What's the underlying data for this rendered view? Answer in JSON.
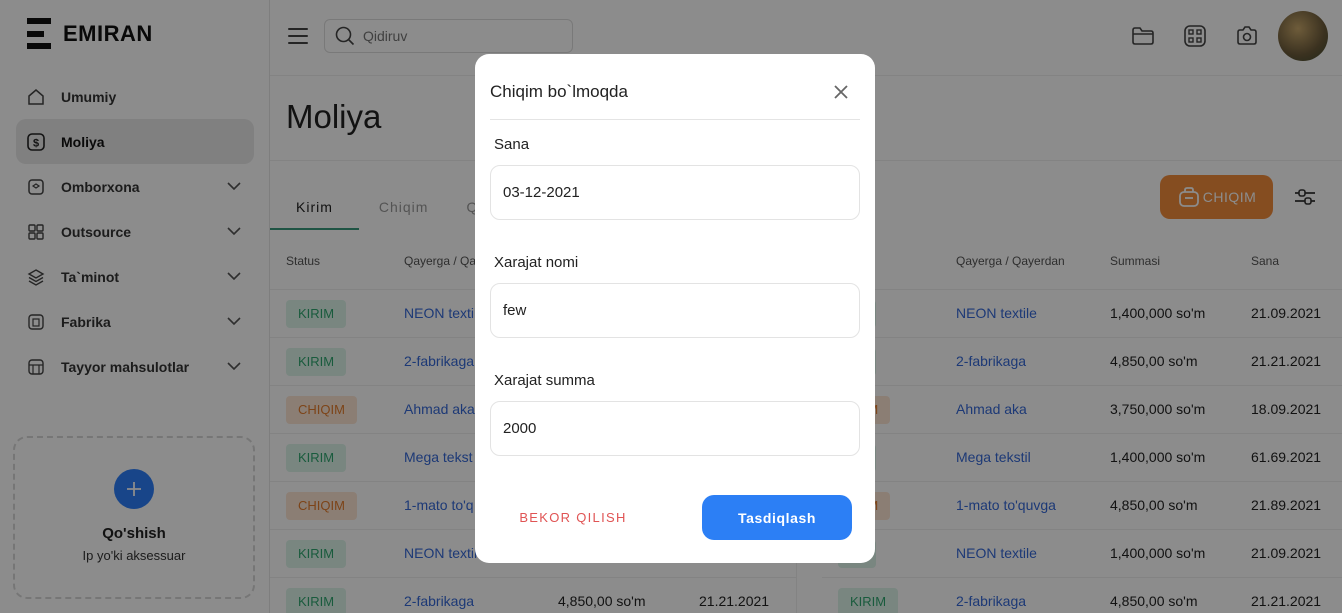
{
  "brand": {
    "name": "EMIRAN"
  },
  "sidebar": {
    "items": [
      {
        "label": "Umumiy",
        "icon": "home-icon",
        "active": false,
        "expandable": false
      },
      {
        "label": "Moliya",
        "icon": "dollar-icon",
        "active": true,
        "expandable": false
      },
      {
        "label": "Omborxona",
        "icon": "box-icon",
        "active": false,
        "expandable": true
      },
      {
        "label": "Outsource",
        "icon": "grid-icon",
        "active": false,
        "expandable": true
      },
      {
        "label": "Ta`minot",
        "icon": "layers-icon",
        "active": false,
        "expandable": true
      },
      {
        "label": "Fabrika",
        "icon": "factory-icon",
        "active": false,
        "expandable": true
      },
      {
        "label": "Tayyor mahsulotlar",
        "icon": "store-icon",
        "active": false,
        "expandable": true
      }
    ],
    "add_card": {
      "title": "Qo'shish",
      "subtitle": "Ip yo'ki aksessuar"
    }
  },
  "header": {
    "search_placeholder": "Qidiruv",
    "icons": [
      "folder-icon",
      "qr-scan-icon",
      "camera-icon"
    ]
  },
  "page": {
    "title": "Moliya",
    "tabs": [
      {
        "label": "Kirim",
        "active": true
      },
      {
        "label": "Chiqim",
        "active": false
      },
      {
        "label": "Q",
        "active": false
      }
    ],
    "action_button": "CHIQIM"
  },
  "table_left": {
    "headers": [
      "Status",
      "Qayerga / Qa"
    ],
    "rows": [
      {
        "status": "KIRIM",
        "type": "kirim",
        "place": "NEON textil",
        "sum": "",
        "date": ""
      },
      {
        "status": "KIRIM",
        "type": "kirim",
        "place": "2-fabrikaga",
        "sum": "",
        "date": ""
      },
      {
        "status": "CHIQIM",
        "type": "chiqim",
        "place": "Ahmad aka",
        "sum": "",
        "date": ""
      },
      {
        "status": "KIRIM",
        "type": "kirim",
        "place": "Mega tekst",
        "sum": "",
        "date": ""
      },
      {
        "status": "CHIQIM",
        "type": "chiqim",
        "place": "1-mato to'q",
        "sum": "",
        "date": ""
      },
      {
        "status": "KIRIM",
        "type": "kirim",
        "place": "NEON textil",
        "sum": "",
        "date": ""
      },
      {
        "status": "KIRIM",
        "type": "kirim",
        "place": "2-fabrikaga",
        "sum": "4,850,00 so'm",
        "date": "21.21.2021"
      }
    ]
  },
  "table_right": {
    "headers": [
      "Qayerga / Qayerdan",
      "Summasi",
      "Sana"
    ],
    "rows": [
      {
        "status": "IM",
        "type": "kirim",
        "place": "NEON textile",
        "sum": "1,400,000 so'm",
        "date": "21.09.2021"
      },
      {
        "status": "IM",
        "type": "kirim",
        "place": "2-fabrikaga",
        "sum": "4,850,00 so'm",
        "date": "21.21.2021"
      },
      {
        "status": "IQIM",
        "type": "chiqim",
        "place": "Ahmad aka",
        "sum": "3,750,000 so'm",
        "date": "18.09.2021"
      },
      {
        "status": "IM",
        "type": "kirim",
        "place": "Mega tekstil",
        "sum": "1,400,000 so'm",
        "date": "61.69.2021"
      },
      {
        "status": "IQIM",
        "type": "chiqim",
        "place": "1-mato to'quvga",
        "sum": "4,850,00 so'm",
        "date": "21.89.2021"
      },
      {
        "status": "IM",
        "type": "kirim",
        "place": "NEON textile",
        "sum": "1,400,000 so'm",
        "date": "21.09.2021"
      },
      {
        "status": "KIRIM",
        "type": "kirim",
        "place": "2-fabrikaga",
        "sum": "4,850,00 so'm",
        "date": "21.21.2021"
      }
    ]
  },
  "modal": {
    "title": "Chiqim bo`lmoqda",
    "fields": [
      {
        "label": "Sana",
        "value": "03-12-2021"
      },
      {
        "label": "Xarajat nomi",
        "value": "few"
      },
      {
        "label": "Xarajat summa",
        "value": "2000"
      }
    ],
    "cancel_label": "BEKOR QILISH",
    "confirm_label": "Tasdiqlash"
  },
  "colors": {
    "primary": "#2c7ff5",
    "accent_orange": "#f28d3b",
    "kirim_text": "#2fa66f",
    "chiqim_text": "#e47c2c",
    "danger": "#e05454",
    "tab_underline": "#3a9a7c"
  }
}
